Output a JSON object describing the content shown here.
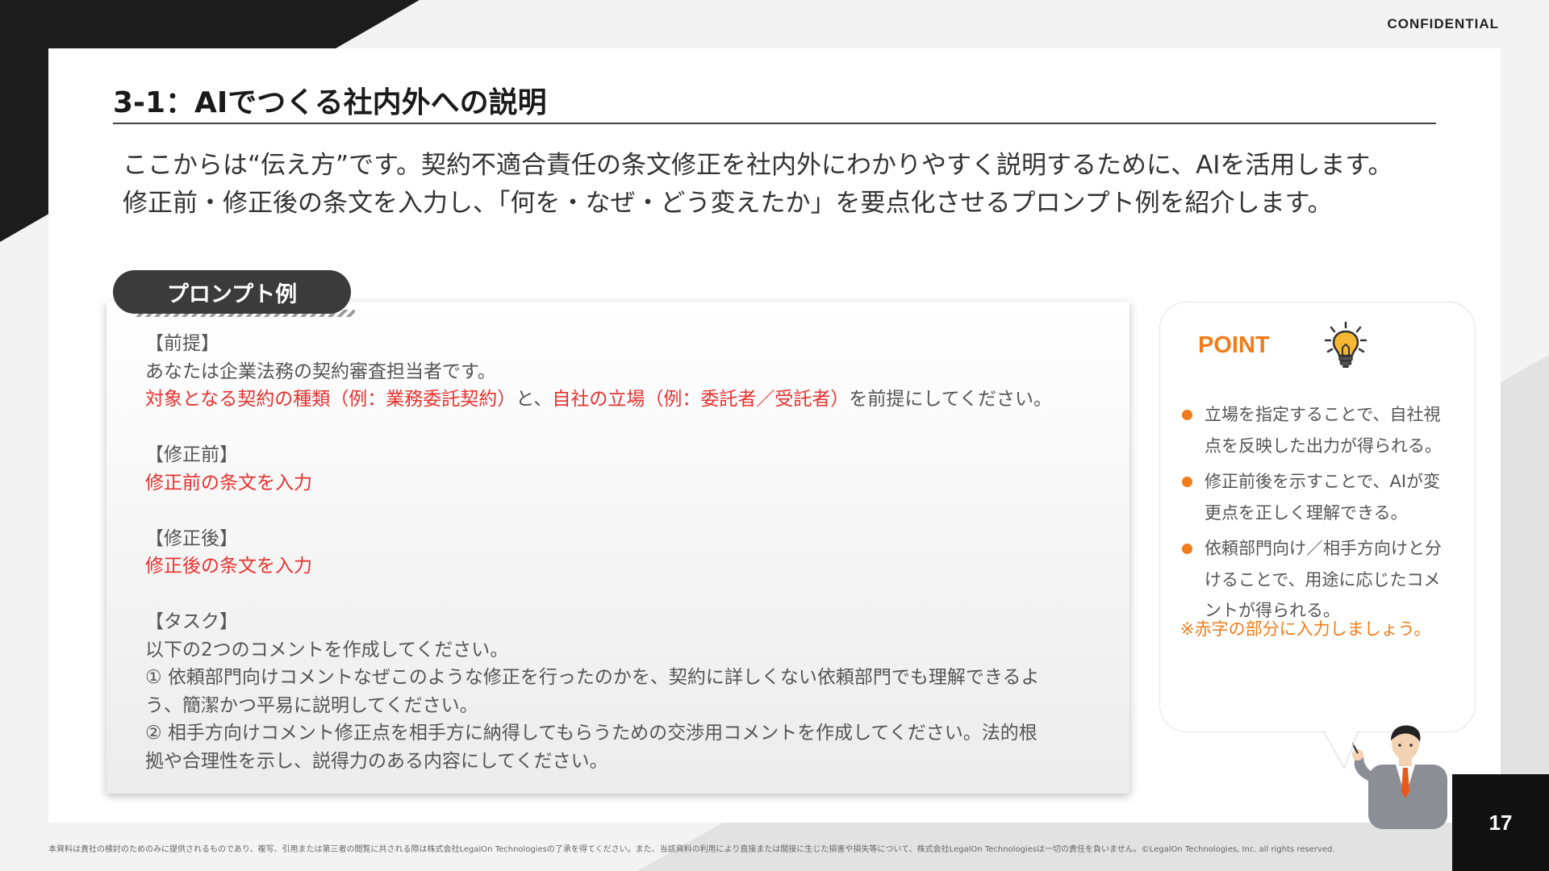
{
  "header": {
    "confidential": "CONFIDENTIAL"
  },
  "slide": {
    "title": "3-1：AIでつくる社内外への説明",
    "intro_lines": [
      "ここからは“伝え方”です。契約不適合責任の条文修正を社内外にわかりやすく説明するために、AIを活用します。",
      "修正前・修正後の条文を入力し、「何を・なぜ・どう変えたか」を要点化させるプロンプト例を紹介します。"
    ]
  },
  "prompt": {
    "tab_label": "プロンプト例",
    "premise_heading": "【前提】",
    "premise_line1": "あなたは企業法務の契約審査担当者です。",
    "premise_red1": "対象となる契約の種類（例：業務委託契約）",
    "premise_mid": "と、",
    "premise_red2": "自社の立場（例：委託者／受託者）",
    "premise_end": "を前提にしてください。",
    "before_heading": "【修正前】",
    "before_input": "修正前の条文を入力",
    "after_heading": "【修正後】",
    "after_input": "修正後の条文を入力",
    "task_heading": "【タスク】",
    "task_line1": "以下の2つのコメントを作成してください。",
    "task_item1_line1": "① 依頼部門向けコメントなぜこのような修正を行ったのかを、契約に詳しくない依頼部門でも理解できるよ",
    "task_item1_line2": "う、簡潔かつ平易に説明してください。",
    "task_item2_line1": "② 相手方向けコメント修正点を相手方に納得してもらうための交渉用コメントを作成してください。法的根",
    "task_item2_line2": "拠や合理性を示し、説得力のある内容にしてください。"
  },
  "point": {
    "heading": "POINT",
    "icon": "lightbulb-icon",
    "items": [
      {
        "line1": "立場を指定することで、自社視",
        "line2": "点を反映した出力が得られる。"
      },
      {
        "line1": "修正前後を示すことで、AIが変",
        "line2": "更点を正しく理解できる。"
      },
      {
        "line1": "依頼部門向け／相手方向けと分",
        "line2": "けることで、用途に応じたコメ",
        "line3": "ントが得られる。"
      }
    ],
    "note": "※赤字の部分に入力しましょう。"
  },
  "footer": {
    "page_number": "17",
    "disclaimer": "本資料は貴社の検討のためのみに提供されるものであり、複写、引用または第三者の閲覧に共される際は株式会社LegalOn Technologiesの了承を得てください。また、当該資料の利用により直接または間接に生じた損害や損失等について、株式会社LegalOn Technologiesは一切の責任を負いません。©LegalOn Technologies, Inc. all rights reserved."
  },
  "colors": {
    "accent": "#f07c1c",
    "red": "#e8312f",
    "dark": "#3b3b3b"
  }
}
